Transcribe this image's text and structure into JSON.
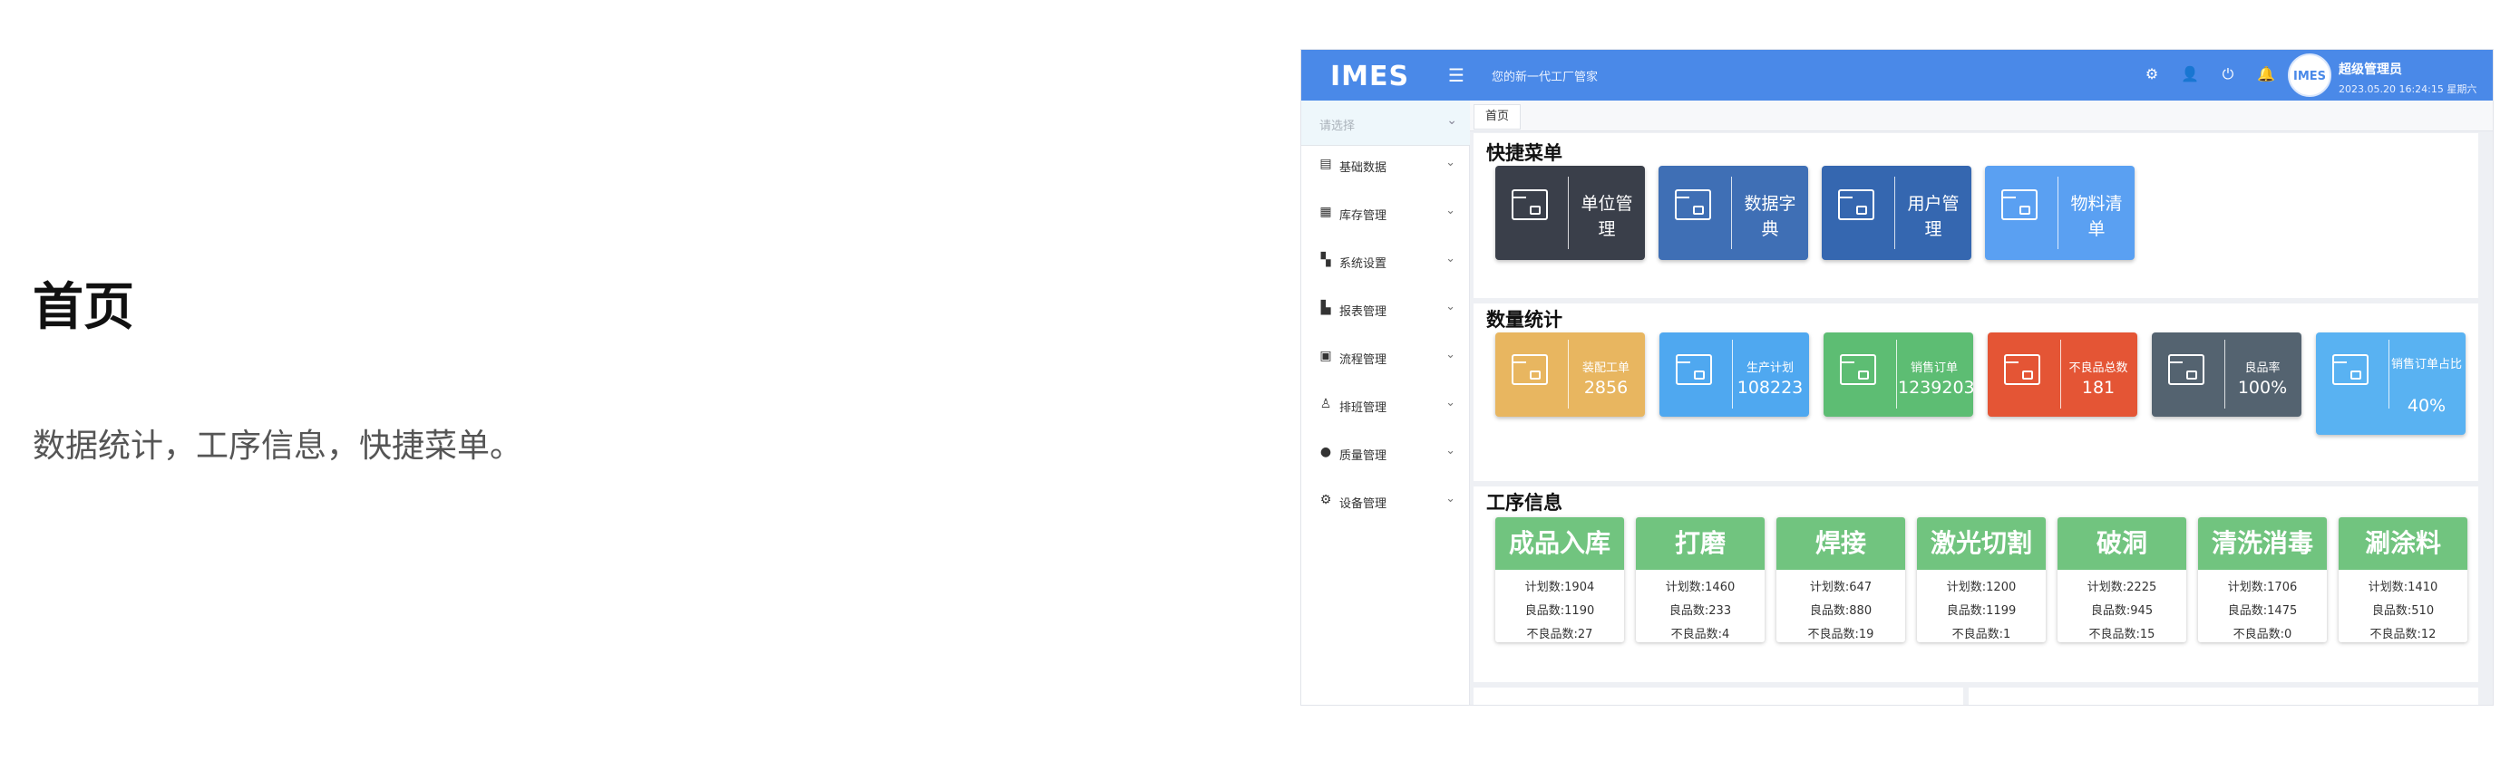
{
  "intro": {
    "title": "首页",
    "description": "数据统计，工序信息，快捷菜单。"
  },
  "topbar": {
    "logo": "IMES",
    "tagline": "您的新一代工厂管家",
    "avatar_text": "IMES",
    "user_name": "超级管理员",
    "datetime": "2023.05.20 16:24:15 星期六",
    "accent": "#4a89e8"
  },
  "sidebar": {
    "select_placeholder": "请选择",
    "items": [
      {
        "label": "基础数据",
        "icon": "document-icon"
      },
      {
        "label": "库存管理",
        "icon": "clipboard-icon"
      },
      {
        "label": "系统设置",
        "icon": "grid-icon"
      },
      {
        "label": "报表管理",
        "icon": "bar-chart-icon"
      },
      {
        "label": "流程管理",
        "icon": "flow-icon"
      },
      {
        "label": "排班管理",
        "icon": "person-icon"
      },
      {
        "label": "质量管理",
        "icon": "alert-icon"
      },
      {
        "label": "设备管理",
        "icon": "gear-icon"
      }
    ]
  },
  "tabs": {
    "home": "首页"
  },
  "quick_menu": {
    "title": "快捷菜单",
    "items": [
      {
        "label": "单位管理",
        "color": "#3a3f4a"
      },
      {
        "label": "数据字典",
        "color": "#3f6fb5"
      },
      {
        "label": "用户管理",
        "color": "#3567b0"
      },
      {
        "label": "物料清单",
        "color": "#5aa0f2"
      }
    ]
  },
  "stats": {
    "title": "数量统计",
    "items": [
      {
        "label": "装配工单",
        "value": "2856",
        "color": "#e8b660"
      },
      {
        "label": "生产计划",
        "value": "108223",
        "color": "#4fa8f0"
      },
      {
        "label": "销售订单",
        "value": "1239203",
        "color": "#5dbd73"
      },
      {
        "label": "不良品总数",
        "value": "181",
        "color": "#e45535"
      },
      {
        "label": "良品率",
        "value": "100%",
        "color": "#546370"
      },
      {
        "label": "销售订单占比",
        "value": "40%",
        "color": "#59b2f2"
      }
    ]
  },
  "process": {
    "title": "工序信息",
    "items": [
      {
        "name": "成品入库",
        "plan": "计划数:1904",
        "good": "良品数:1190",
        "bad": "不良品数:27"
      },
      {
        "name": "打磨",
        "plan": "计划数:1460",
        "good": "良品数:233",
        "bad": "不良品数:4"
      },
      {
        "name": "焊接",
        "plan": "计划数:647",
        "good": "良品数:880",
        "bad": "不良品数:19"
      },
      {
        "name": "激光切割",
        "plan": "计划数:1200",
        "good": "良品数:1199",
        "bad": "不良品数:1"
      },
      {
        "name": "破洞",
        "plan": "计划数:2225",
        "good": "良品数:945",
        "bad": "不良品数:15"
      },
      {
        "name": "清洗消毒",
        "plan": "计划数:1706",
        "good": "良品数:1475",
        "bad": "不良品数:0"
      },
      {
        "name": "涮涂料",
        "plan": "计划数:1410",
        "good": "良品数:510",
        "bad": "不良品数:12"
      }
    ]
  }
}
